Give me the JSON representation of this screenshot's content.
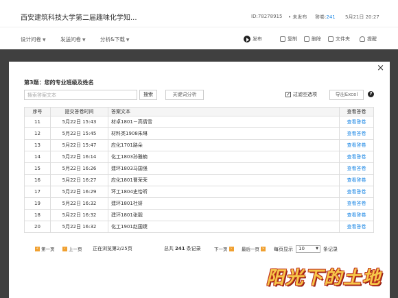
{
  "header": {
    "title": "西安建筑科技大学第二届趣味化学知...",
    "id": "ID:78278915",
    "status": "• 未发布",
    "answers_label": "答卷:",
    "answers_count": "241",
    "date": "5月21日 20:27"
  },
  "toolbar": {
    "menus": [
      {
        "label": "设计问卷"
      },
      {
        "label": "发送问卷"
      },
      {
        "label": "分析&下载"
      }
    ],
    "actions": [
      {
        "label": "发布",
        "icon": "play-icon"
      },
      {
        "label": "复制",
        "icon": "copy-icon"
      },
      {
        "label": "删除",
        "icon": "trash-icon"
      },
      {
        "label": "文件夹",
        "icon": "folder-icon"
      },
      {
        "label": "提醒",
        "icon": "bell-icon"
      }
    ]
  },
  "dialog": {
    "close": "×",
    "question_title": "第3题：您的专业班级及姓名",
    "search_placeholder": "搜索答案文本",
    "search_button": "搜索",
    "keyword_button": "关键词分析",
    "filter_label": "过滤空选项",
    "filter_checked": "✓",
    "export_button": "导出Excel",
    "help": "?",
    "columns": [
      "序号",
      "提交答卷时间",
      "答案文本",
      "查看答卷"
    ],
    "rows": [
      {
        "no": "11",
        "time": "5月22日 15:43",
        "text": "材卓1801－高倩雪",
        "view": "查看答卷"
      },
      {
        "no": "12",
        "time": "5月22日 15:45",
        "text": "材料类1908朱琳",
        "view": "查看答卷"
      },
      {
        "no": "13",
        "time": "5月22日 15:47",
        "text": "应化1701路朵",
        "view": "查看答卷"
      },
      {
        "no": "14",
        "time": "5月22日 16:14",
        "text": "化工1803孙雅楠",
        "view": "查看答卷"
      },
      {
        "no": "15",
        "time": "5月22日 16:26",
        "text": "建环1803马国强",
        "view": "查看答卷"
      },
      {
        "no": "16",
        "time": "5月22日 16:27",
        "text": "应化1801曹荣荣",
        "view": "查看答卷"
      },
      {
        "no": "17",
        "time": "5月22日 16:29",
        "text": "环工1804史怡昕",
        "view": "查看答卷"
      },
      {
        "no": "19",
        "time": "5月22日 16:32",
        "text": "建环1801杜妍",
        "view": "查看答卷"
      },
      {
        "no": "18",
        "time": "5月22日 16:32",
        "text": "建环1801张靓",
        "view": "查看答卷"
      },
      {
        "no": "20",
        "time": "5月22日 16:32",
        "text": "化工1901赵国婕",
        "view": "查看答卷"
      }
    ],
    "pager": {
      "first": "第一页",
      "prev": "上一页",
      "status": "正在浏览第2/25页",
      "total_prefix": "总共",
      "total_count": "241",
      "total_suffix": "条记录",
      "next": "下一页",
      "last": "最后一页",
      "per_page_label": "每页显示",
      "per_page_value": "10",
      "per_page_suffix": "条记录"
    }
  },
  "watermark": "阳光下的土地"
}
